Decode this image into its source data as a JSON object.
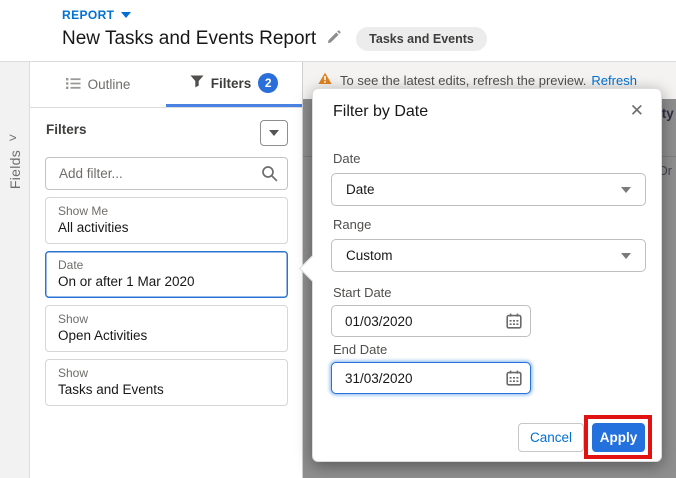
{
  "header": {
    "report_label": "REPORT",
    "title": "New Tasks and Events Report",
    "report_type_badge": "Tasks and Events"
  },
  "fields_rail": {
    "label": "Fields",
    "expand_chevron": ">"
  },
  "panel": {
    "tabs": [
      {
        "label": "Outline"
      },
      {
        "label": "Filters",
        "badge": "2"
      }
    ],
    "heading": "Filters",
    "add_filter_placeholder": "Add filter...",
    "filters": [
      {
        "label": "Show Me",
        "value": "All activities"
      },
      {
        "label": "Date",
        "value": "On or after 1 Mar 2020"
      },
      {
        "label": "Show",
        "value": "Open Activities"
      },
      {
        "label": "Show",
        "value": "Tasks and Events"
      }
    ]
  },
  "preview": {
    "warning_text": "To see the latest edits, refresh the preview.",
    "refresh_link": "Refresh",
    "partial_column_header": "ity",
    "partial_cell_text": "Or"
  },
  "dialog": {
    "title": "Filter by Date",
    "close_glyph": "✕",
    "date": {
      "label": "Date",
      "value": "Date"
    },
    "range": {
      "label": "Range",
      "value": "Custom"
    },
    "start_date": {
      "label": "Start Date",
      "value": "01/03/2020"
    },
    "end_date": {
      "label": "End Date",
      "value": "31/03/2020"
    },
    "cancel_label": "Cancel",
    "apply_label": "Apply"
  },
  "colors": {
    "accent_blue": "#0070d2",
    "tab_underline_blue": "#4a82e4",
    "badge_blue": "#2a6fd9",
    "apply_button_blue": "#2470dd",
    "selected_card_border": "#2b73d2",
    "annotation_red": "#e01212",
    "warning_orange": "#e0821e",
    "backdrop_gray": "#8f8f8f"
  }
}
